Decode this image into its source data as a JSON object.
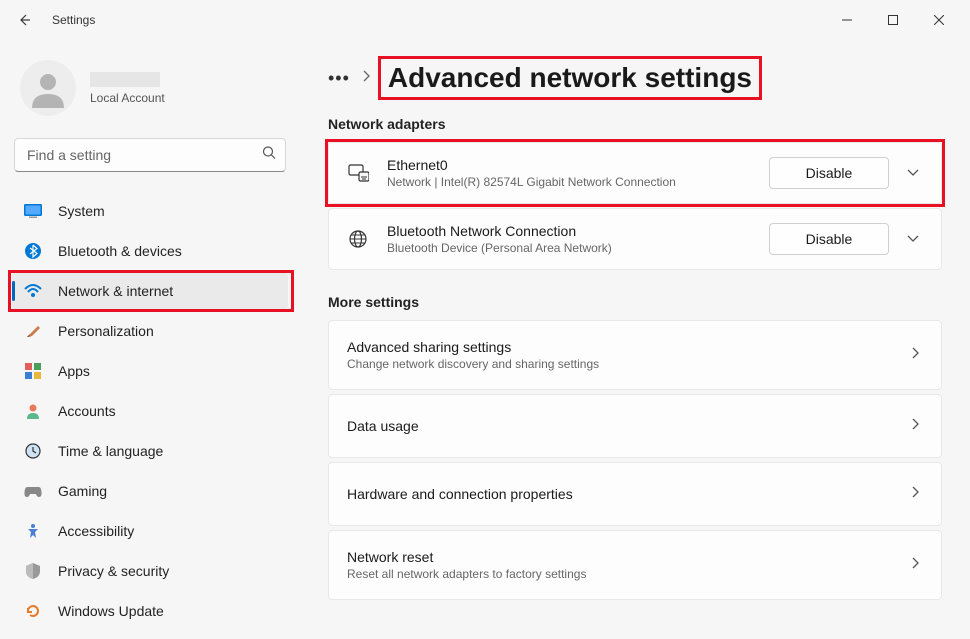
{
  "window": {
    "title": "Settings"
  },
  "profile": {
    "account_type": "Local Account"
  },
  "search": {
    "placeholder": "Find a setting"
  },
  "sidebar": {
    "items": [
      {
        "label": "System"
      },
      {
        "label": "Bluetooth & devices"
      },
      {
        "label": "Network & internet"
      },
      {
        "label": "Personalization"
      },
      {
        "label": "Apps"
      },
      {
        "label": "Accounts"
      },
      {
        "label": "Time & language"
      },
      {
        "label": "Gaming"
      },
      {
        "label": "Accessibility"
      },
      {
        "label": "Privacy & security"
      },
      {
        "label": "Windows Update"
      }
    ]
  },
  "page": {
    "title": "Advanced network settings"
  },
  "sections": {
    "adapters_label": "Network adapters",
    "more_label": "More settings"
  },
  "adapters": [
    {
      "name": "Ethernet0",
      "detail": "Network | Intel(R) 82574L Gigabit Network Connection",
      "action": "Disable"
    },
    {
      "name": "Bluetooth Network Connection",
      "detail": "Bluetooth Device (Personal Area Network)",
      "action": "Disable"
    }
  ],
  "more_settings": [
    {
      "title": "Advanced sharing settings",
      "sub": "Change network discovery and sharing settings"
    },
    {
      "title": "Data usage",
      "sub": ""
    },
    {
      "title": "Hardware and connection properties",
      "sub": ""
    },
    {
      "title": "Network reset",
      "sub": "Reset all network adapters to factory settings"
    }
  ]
}
